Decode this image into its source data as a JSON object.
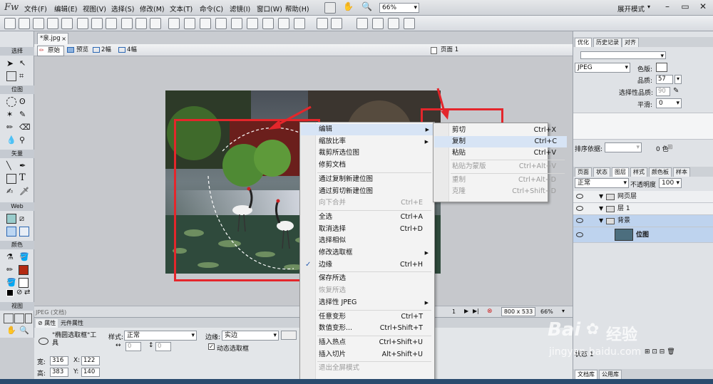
{
  "app": {
    "logo": "Fw",
    "workspace": "展开模式",
    "zoom_select": "66%"
  },
  "menu": [
    "文件(F)",
    "编辑(E)",
    "视图(V)",
    "选择(S)",
    "修改(M)",
    "文本(T)",
    "命令(C)",
    "滤镜(I)",
    "窗口(W)",
    "帮助(H)"
  ],
  "tools": {
    "sections": [
      "选择",
      "位图",
      "矢量",
      "Web",
      "颜色",
      "视图"
    ]
  },
  "document": {
    "tab": "*泉.jpg",
    "view_buttons": [
      "原始",
      "预览",
      "2幅",
      "4幅"
    ],
    "page_label": "页面 1"
  },
  "status": {
    "left": "JPEG (文档)",
    "frame": "1",
    "size": "800 x 533",
    "zoom": "66%"
  },
  "props": {
    "tabs": [
      "属性",
      "元件属性"
    ],
    "tool_name": "\"椭圆选取框\"工具",
    "style_label": "样式:",
    "style_value": "正常",
    "edge_label": "边缘:",
    "edge_value": "实边",
    "w_label": "宽:",
    "w": "316",
    "h_label": "高:",
    "h": "383",
    "x_label": "X:",
    "x": "122",
    "y_label": "Y:",
    "y": "140",
    "dyn_marquee": "动态选取框",
    "fixed_w": "0",
    "fixed_h": "0"
  },
  "right_panel": {
    "top_tabs": [
      "优化",
      "历史记录",
      "对齐"
    ],
    "format": "JPEG",
    "matte_label": "色版:",
    "quality_label": "品质:",
    "quality": "57",
    "sel_quality_label": "选择性品质:",
    "sel_quality": "90",
    "smooth_label": "平滑:",
    "smooth": "0",
    "sort_label": "排序依据:",
    "colors": "0 色",
    "layer_tabs": [
      "页面",
      "状态",
      "图层",
      "样式",
      "颜色板",
      "样本"
    ],
    "blend": "正常",
    "opacity_label": "不透明度",
    "opacity": "100",
    "layers": [
      "网页层",
      "层 1",
      "背景",
      "位图"
    ],
    "state_label": "状态 1",
    "bottom_tabs": [
      "文档库",
      "公用库"
    ]
  },
  "context_menu": [
    {
      "label": "编辑",
      "shortcut": "",
      "submenu": true,
      "disabled": false,
      "highlight": true
    },
    {
      "label": "缩放比率",
      "shortcut": "",
      "submenu": true,
      "disabled": false
    },
    {
      "label": "裁剪所选位图",
      "shortcut": "",
      "disabled": false
    },
    {
      "label": "修剪文档",
      "shortcut": "",
      "disabled": false
    },
    {
      "label": "通过复制新建位图",
      "shortcut": "",
      "disabled": false,
      "sep_before": true
    },
    {
      "label": "通过剪切新建位图",
      "shortcut": "",
      "disabled": false
    },
    {
      "label": "向下合并",
      "shortcut": "Ctrl+E",
      "disabled": true
    },
    {
      "label": "全选",
      "shortcut": "Ctrl+A",
      "disabled": false,
      "sep_before": true
    },
    {
      "label": "取消选择",
      "shortcut": "Ctrl+D",
      "disabled": false
    },
    {
      "label": "选择相似",
      "shortcut": "",
      "disabled": false
    },
    {
      "label": "修改选取框",
      "shortcut": "",
      "submenu": true,
      "disabled": false
    },
    {
      "label": "边缘",
      "shortcut": "Ctrl+H",
      "disabled": false,
      "checked": true
    },
    {
      "label": "保存所选",
      "shortcut": "",
      "disabled": false,
      "sep_before": true
    },
    {
      "label": "恢复所选",
      "shortcut": "",
      "disabled": true
    },
    {
      "label": "选择性 JPEG",
      "shortcut": "",
      "submenu": true,
      "disabled": false
    },
    {
      "label": "任意变形",
      "shortcut": "Ctrl+T",
      "disabled": false,
      "sep_before": true
    },
    {
      "label": "数值变形...",
      "shortcut": "Ctrl+Shift+T",
      "disabled": false
    },
    {
      "label": "插入热点",
      "shortcut": "Ctrl+Shift+U",
      "disabled": false,
      "sep_before": true
    },
    {
      "label": "插入切片",
      "shortcut": "Alt+Shift+U",
      "disabled": false
    },
    {
      "label": "退出全屏模式",
      "shortcut": "",
      "disabled": true,
      "sep_before": true
    }
  ],
  "submenu": [
    {
      "label": "剪切",
      "shortcut": "Ctrl+X",
      "disabled": false
    },
    {
      "label": "复制",
      "shortcut": "Ctrl+C",
      "disabled": false,
      "highlight": true
    },
    {
      "label": "粘贴",
      "shortcut": "Ctrl+V",
      "disabled": false
    },
    {
      "label": "粘贴为蒙版",
      "shortcut": "Ctrl+Alt+V",
      "disabled": true,
      "sep_before": true
    },
    {
      "label": "重制",
      "shortcut": "Ctrl+Alt+D",
      "disabled": true,
      "sep_before": true
    },
    {
      "label": "克隆",
      "shortcut": "Ctrl+Shift+D",
      "disabled": true
    }
  ],
  "watermark": {
    "brand": "Bai",
    "brand2": "经验",
    "url": "jingyan.baidu.com"
  },
  "colors": {
    "accent_red": "#e4262b",
    "highlight": "#d7e4f5",
    "stroke_color": "#b32a12"
  }
}
